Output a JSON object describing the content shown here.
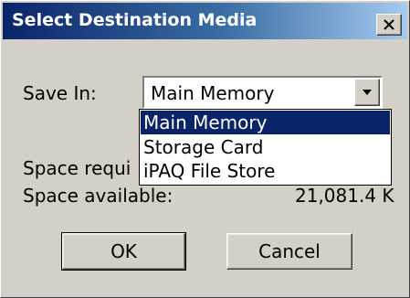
{
  "window": {
    "title": "Select Destination Media",
    "close_glyph": "✕",
    "colors": {
      "titlebar_start": "#0a246a",
      "titlebar_end": "#a6caf0",
      "face": "#d4d0c8",
      "selection": "#0a246a"
    }
  },
  "form": {
    "save_in_label": "Save In:",
    "save_in_value": "Main Memory",
    "dropdown_options": [
      "Main Memory",
      "Storage Card",
      "iPAQ File Store"
    ],
    "selected_option": "Main Memory",
    "space_required_label": "Space requi",
    "space_available_label": "Space available:",
    "space_available_value": "21,081.4 K"
  },
  "buttons": {
    "ok_label": "OK",
    "cancel_label": "Cancel"
  },
  "icons": {
    "close": "close-icon",
    "dropdown": "chevron-down-icon"
  }
}
